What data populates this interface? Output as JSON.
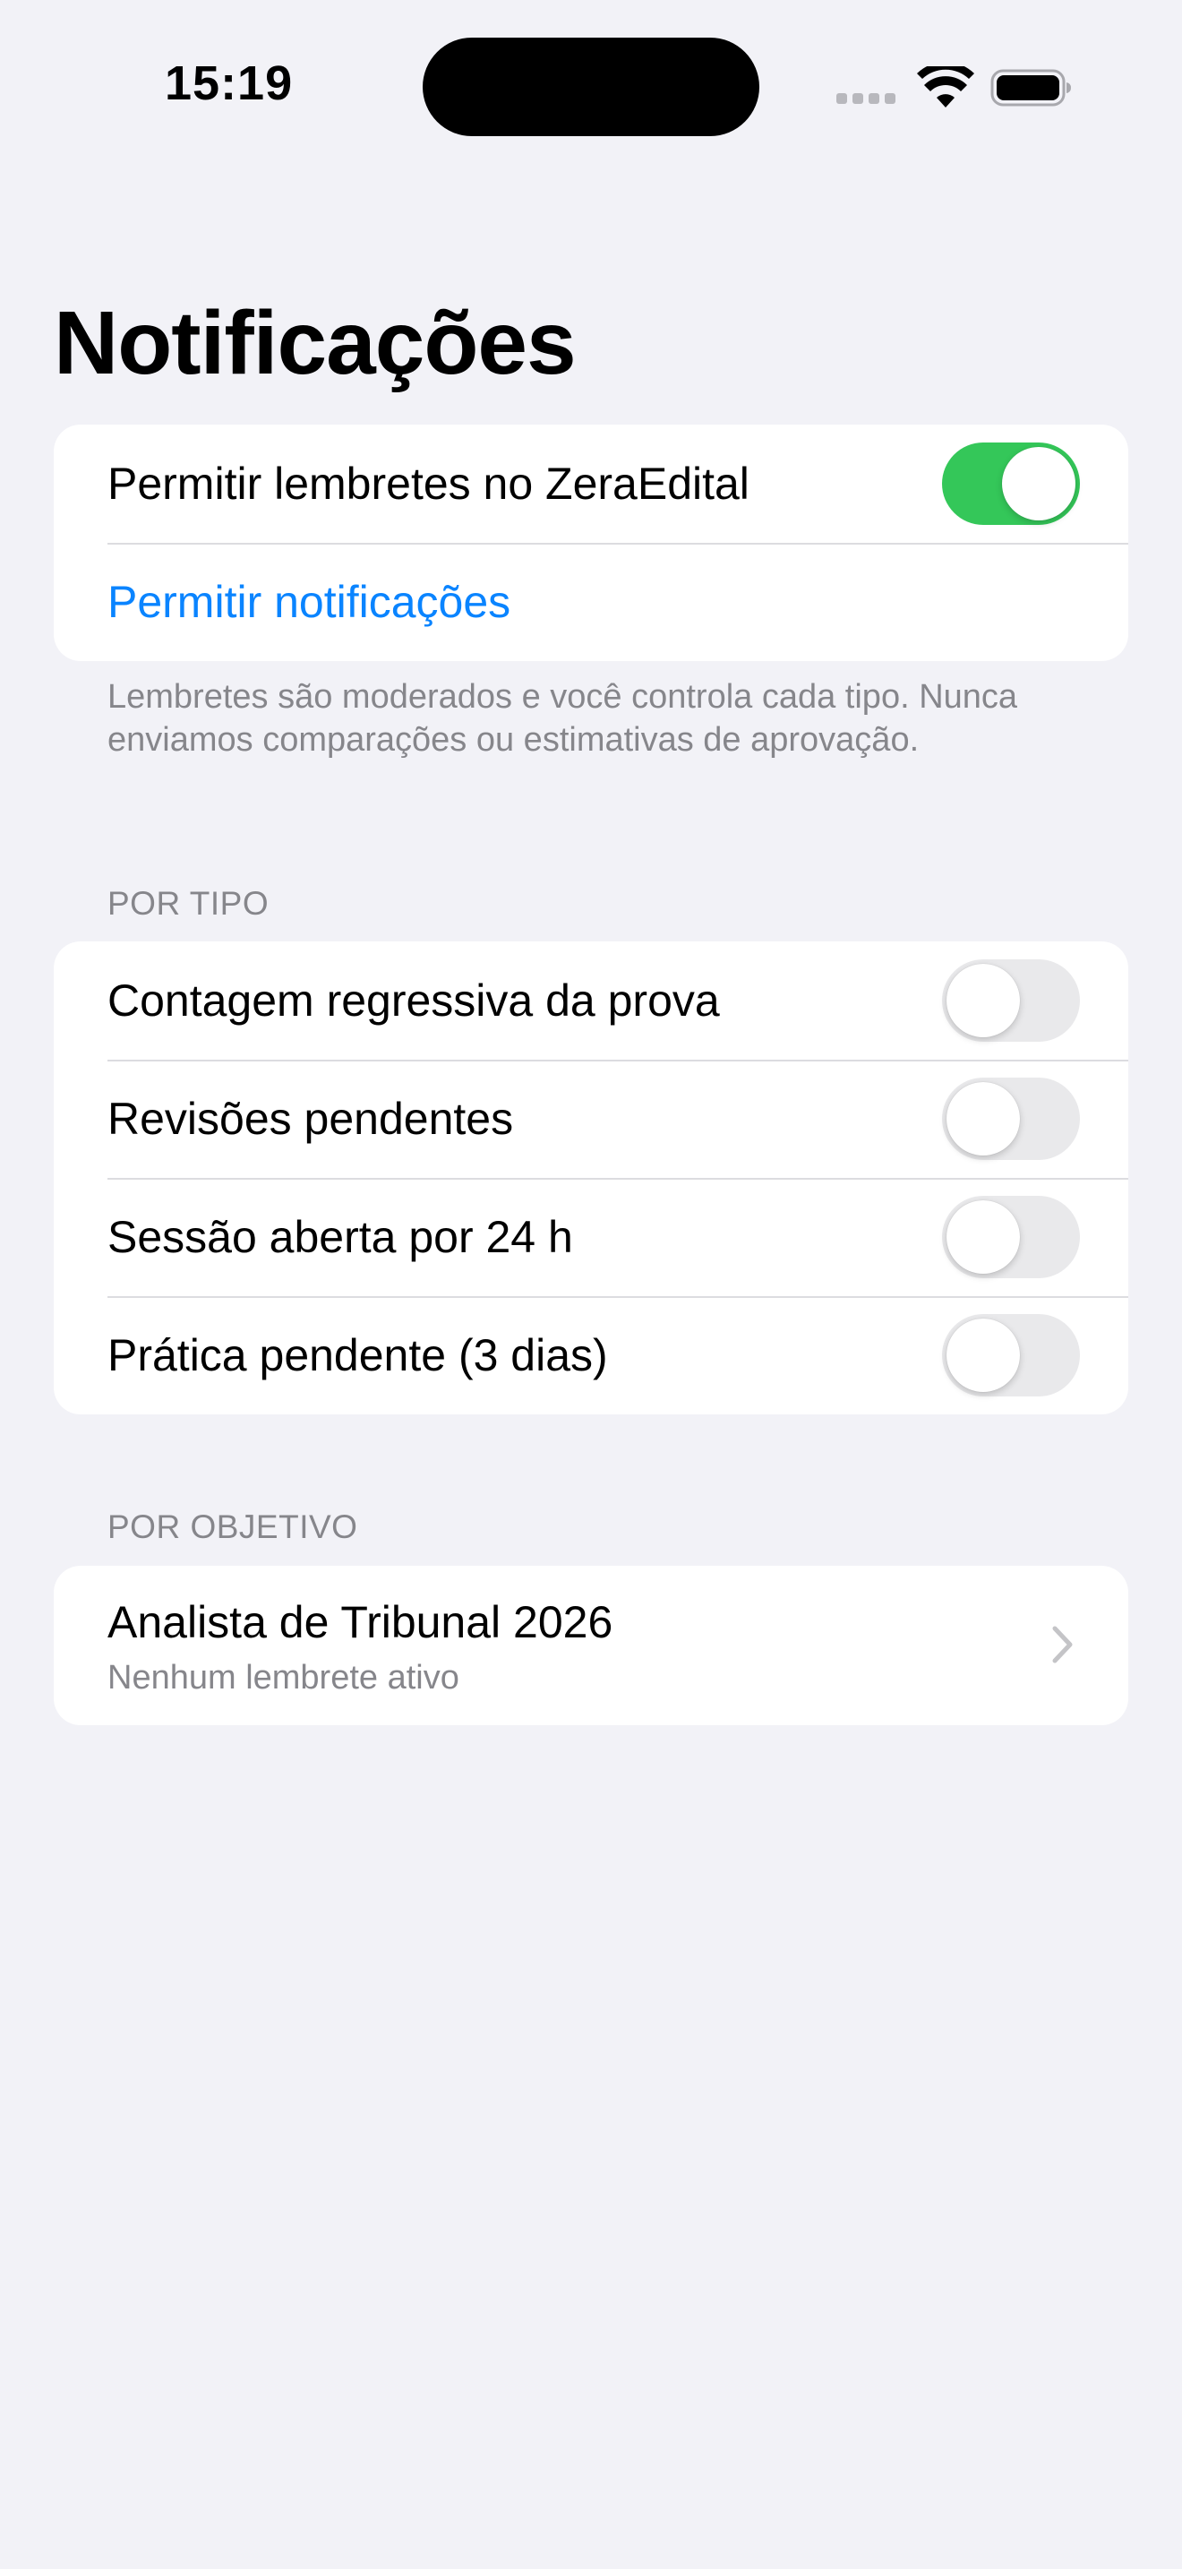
{
  "status_bar": {
    "time": "15:19",
    "icons": [
      "cellular-signal-icon",
      "wifi-icon",
      "battery-icon"
    ]
  },
  "page": {
    "title": "Notificações"
  },
  "permission": {
    "allow_reminders_label": "Permitir lembretes no ZeraEdital",
    "allow_reminders_on": true,
    "allow_notifications_link": "Permitir notificações",
    "footer": "Lembretes são moderados e você controla cada tipo. Nunca enviamos comparações ou estimativas de aprovação."
  },
  "by_type": {
    "header": "POR TIPO",
    "items": [
      {
        "label": "Contagem regressiva da prova",
        "on": false
      },
      {
        "label": "Revisões pendentes",
        "on": false
      },
      {
        "label": "Sessão aberta por 24 h",
        "on": false
      },
      {
        "label": "Prática pendente (3 dias)",
        "on": false
      }
    ]
  },
  "by_goal": {
    "header": "POR OBJETIVO",
    "items": [
      {
        "title": "Analista de Tribunal 2026",
        "subtitle": "Nenhum lembrete ativo"
      }
    ]
  },
  "colors": {
    "background": "#f2f2f7",
    "accent_link": "#0a84ff",
    "toggle_on": "#34c759",
    "toggle_off": "#e9e9eb",
    "secondary_text": "#86868b"
  }
}
